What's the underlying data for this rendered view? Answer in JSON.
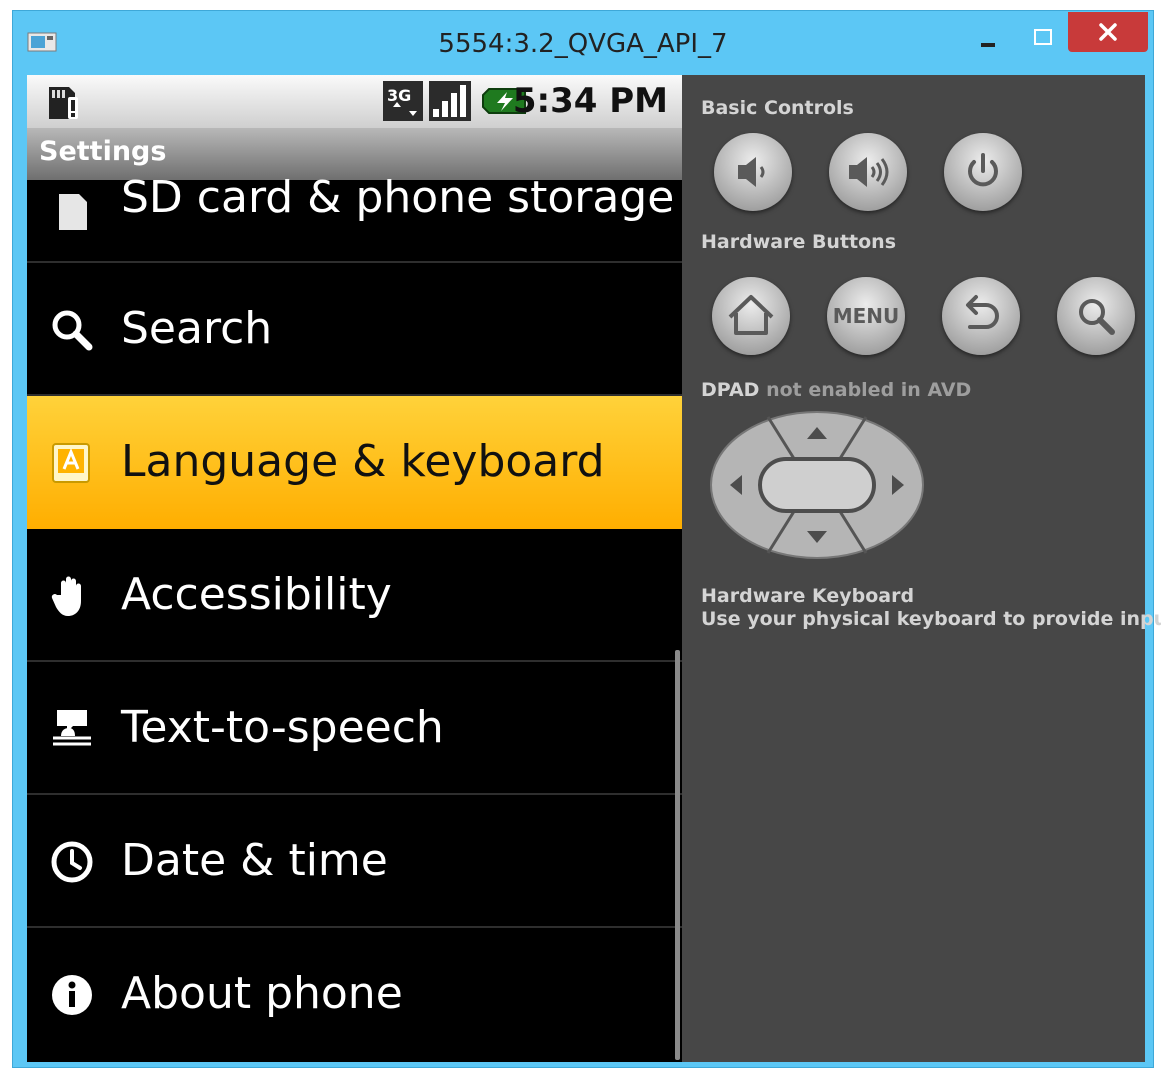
{
  "window": {
    "title": "5554:3.2_QVGA_API_7",
    "close_glyph": "✕",
    "min_glyph": "–",
    "colors": {
      "frame": "#5cc7f5",
      "close": "#c83a3a"
    }
  },
  "statusbar": {
    "time": "5:34 PM",
    "network": "3G",
    "icons": [
      "sd-card-alert-icon",
      "3g-data-icon",
      "signal-icon",
      "battery-charging-icon"
    ]
  },
  "app": {
    "title": "Settings"
  },
  "settings": {
    "items": [
      {
        "label": "SD card & phone storage",
        "icon": "sd-card-icon"
      },
      {
        "label": "Search",
        "icon": "search-icon"
      },
      {
        "label": "Language & keyboard",
        "icon": "language-icon",
        "selected": true
      },
      {
        "label": "Accessibility",
        "icon": "hand-icon"
      },
      {
        "label": "Text-to-speech",
        "icon": "text-to-speech-icon"
      },
      {
        "label": "Date & time",
        "icon": "clock-icon"
      },
      {
        "label": "About phone",
        "icon": "info-icon"
      }
    ],
    "colors": {
      "selected": "#ffb300",
      "background": "#000000"
    }
  },
  "controls": {
    "basic_heading": "Basic Controls",
    "basic_buttons": [
      "volume-down-icon",
      "volume-up-icon",
      "power-icon"
    ],
    "hardware_heading": "Hardware Buttons",
    "hardware_buttons": [
      "home-icon",
      "menu-icon",
      "back-icon",
      "search-icon"
    ],
    "menu_label": "MENU",
    "dpad_prefix": "DPAD",
    "dpad_suffix": "not enabled in AVD",
    "keyboard_heading": "Hardware Keyboard",
    "keyboard_desc": "Use your physical keyboard to provide input",
    "colors": {
      "panel": "#474747"
    }
  }
}
